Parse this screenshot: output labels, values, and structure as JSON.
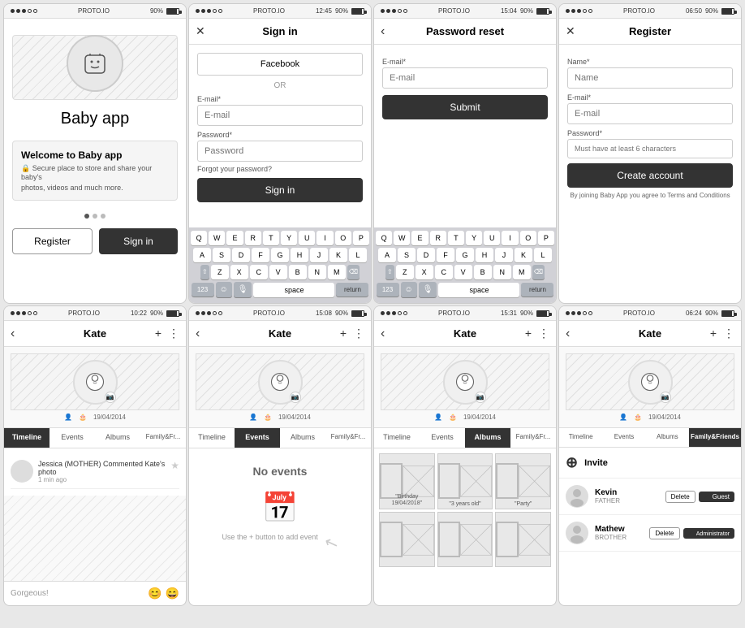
{
  "screens": {
    "splash": {
      "app_title": "Baby app",
      "welcome_title": "Welcome to Baby app",
      "welcome_lock_text": "🔒 Secure place to store and share your baby's",
      "welcome_sub_text": "photos, videos and much more.",
      "register_btn": "Register",
      "signin_btn": "Sign in"
    },
    "signin": {
      "title": "Sign in",
      "facebook_btn": "Facebook",
      "or_text": "OR",
      "email_label": "E-mail*",
      "email_placeholder": "E-mail",
      "password_label": "Password*",
      "password_placeholder": "Password",
      "forgot_text": "Forgot your password?",
      "signin_btn": "Sign in"
    },
    "password_reset": {
      "title": "Password reset",
      "email_label": "E-mail*",
      "email_placeholder": "E-mail",
      "submit_btn": "Submit"
    },
    "register": {
      "title": "Register",
      "name_label": "Name*",
      "name_placeholder": "Name",
      "email_label": "E-mail*",
      "email_placeholder": "E-mail",
      "password_label": "Password*",
      "password_hint": "Must have at least 6 characters",
      "create_btn": "Create account",
      "terms_text": "By joining Baby App you agree to Terms and Conditions"
    },
    "timeline": {
      "title": "Kate",
      "date": "19/04/2014",
      "tabs": [
        "Timeline",
        "Events",
        "Albums",
        "Family&Fr..."
      ],
      "active_tab": 0,
      "comment_author": "Jessica (MOTHER)  Commented",
      "comment_target": "Kate's photo",
      "comment_time": "1 min ago",
      "comment_placeholder": "Gorgeous!",
      "emojis": [
        "😊",
        "😄"
      ]
    },
    "events": {
      "title": "Kate",
      "date": "19/04/2014",
      "tabs": [
        "Timeline",
        "Events",
        "Albums",
        "Family&Fr..."
      ],
      "active_tab": 1,
      "no_events_title": "No events",
      "no_events_hint": "Use the + button to add\nevent"
    },
    "albums": {
      "title": "Kate",
      "date": "19/04/2014",
      "tabs": [
        "Timeline",
        "Events",
        "Albums",
        "Family&Fr..."
      ],
      "active_tab": 2,
      "album_labels": [
        "\"Birthday\n19/04/2018\"",
        "\"3 years old\"",
        "\"Party\""
      ]
    },
    "family": {
      "title": "Kate",
      "date": "19/04/2014",
      "tabs": [
        "Timeline",
        "Events",
        "Albums",
        "Family&Friends"
      ],
      "active_tab": 3,
      "invite_label": "Invite",
      "persons": [
        {
          "name": "Kevin",
          "role": "FATHER",
          "delete_btn": "Delete",
          "role_btn": "✓ Guest"
        },
        {
          "name": "Mathew",
          "role": "BROTHER",
          "delete_btn": "Delete",
          "role_btn": "✓ Administrator"
        }
      ]
    }
  },
  "status_bar": {
    "proto": "PROTO.IO",
    "time1": "12:45",
    "time2": "15:04",
    "time3": "06:50",
    "time4": "10:22",
    "time5": "15:08",
    "time6": "15:31",
    "time7": "06:24",
    "battery": "90%"
  },
  "keyboard": {
    "rows": [
      [
        "Q",
        "W",
        "E",
        "R",
        "T",
        "Y",
        "U",
        "I",
        "O",
        "P"
      ],
      [
        "A",
        "S",
        "D",
        "F",
        "G",
        "H",
        "J",
        "K",
        "L"
      ],
      [
        "Z",
        "X",
        "C",
        "V",
        "B",
        "N",
        "M"
      ],
      [
        "123",
        "space",
        "return"
      ]
    ]
  }
}
